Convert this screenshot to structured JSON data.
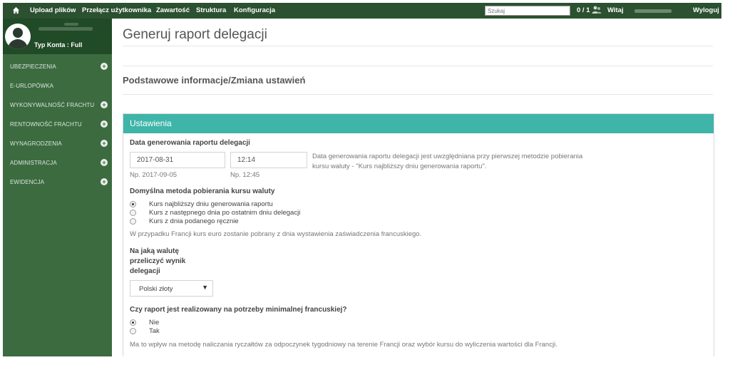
{
  "topbar": {
    "nav": [
      "Upload plików",
      "Przełącz użytkownika",
      "Zawartość",
      "Struktura",
      "Konfiguracja"
    ],
    "search_placeholder": "Szukaj",
    "counter": "0 / 1",
    "greeting": "Witaj",
    "logout": "Wyloguj"
  },
  "sidebar": {
    "account_type": "Typ Konta : Full",
    "items": [
      {
        "label": "UBEZPIECZENIA",
        "expandable": true
      },
      {
        "label": "E-URLOPÓWKA",
        "expandable": false
      },
      {
        "label": "WYKONYWALNOŚĆ FRACHTU",
        "expandable": true
      },
      {
        "label": "RENTOWNOŚĆ FRACHTU",
        "expandable": true
      },
      {
        "label": "WYNAGRODZENIA",
        "expandable": true
      },
      {
        "label": "ADMINISTRACJA",
        "expandable": true
      },
      {
        "label": "EWIDENCJA",
        "expandable": true
      }
    ]
  },
  "main": {
    "page_title": "Generuj raport delegacji",
    "section_title": "Podstawowe informacje/Zmiana ustawień",
    "panel": {
      "header": "Ustawienia",
      "date_label": "Data generowania raportu delegacji",
      "date_value": "2017-08-31",
      "time_value": "12:14",
      "date_hint": "Np. 2017-09-05",
      "time_hint": "Np. 12:45",
      "date_help_line1": "Data generowania raportu delegacji jest uwzględniana przy pierwszej metodzie pobierania",
      "date_help_line2": "kursu waluty - \"Kurs najbliższy dniu generowania raportu\".",
      "method_label": "Domyślna metoda pobierania kursu waluty",
      "method_options": [
        {
          "label": "Kurs najbliższy dniu generowania raportu",
          "checked": true
        },
        {
          "label": "Kurs z następnego dnia po ostatnim dniu delegacji",
          "checked": false
        },
        {
          "label": "Kurs z dnia podanego ręcznie",
          "checked": false
        }
      ],
      "method_note": "W przypadku Francji kurs euro zostanie pobrany z dnia wystawienia zaświadczenia francuskiego.",
      "currency_label_lines": [
        "Na jaką walutę",
        "przeliczyć wynik",
        "delegacji"
      ],
      "currency_selected": "Polski złoty",
      "french_label": "Czy raport jest realizowany na potrzeby minimalnej francuskiej?",
      "french_options": [
        {
          "label": "Nie",
          "checked": true
        },
        {
          "label": "Tak",
          "checked": false
        }
      ],
      "french_note": "Ma to wpływ na metodę naliczania ryczałtów za odpoczynek tygodniowy na terenie Francji oraz wybór kursu do wyliczenia wartości dla Francji."
    }
  },
  "colors": {
    "topbar": "#2b5130",
    "sidebar": "#3c6b40",
    "profile": "#214a27",
    "panel_header": "#3fb4a9"
  }
}
